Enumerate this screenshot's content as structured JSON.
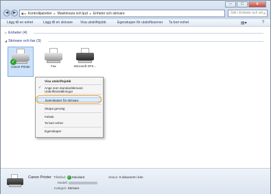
{
  "address": {
    "crumbs": [
      "Kontrollpanelen",
      "Maskinvara och ljud",
      "Enheter och skrivare"
    ],
    "search_placeholder": "Sök i Enheter och skr..."
  },
  "window_controls": {
    "minimize": "–",
    "maximize": "□",
    "close": "x"
  },
  "toolbar": {
    "items": [
      "Lägg till en enhet",
      "Lägg till en skrivare",
      "Visa utskriftsjobb",
      "Egenskaper för utskriftsserver",
      "Ta bort enhet"
    ]
  },
  "groups": {
    "devices": "Enheter (4)",
    "printers": "Skrivare och fax (3)"
  },
  "printers": [
    {
      "label": "Canon Printer",
      "status": "default"
    },
    {
      "label": "Fax",
      "status": ""
    },
    {
      "label": "Microsoft XPS...",
      "status": ""
    }
  ],
  "context_menu": {
    "items": [
      {
        "label": "Visa utskriftsjobb",
        "bold": true,
        "checked": false
      },
      {
        "label": "Ange som standardskrivare",
        "bold": false,
        "checked": true
      },
      {
        "label": "Utskriftsinställningar",
        "bold": false,
        "checked": false
      },
      {
        "label": "Egenskaper för skrivare",
        "bold": false,
        "checked": false,
        "highlighted": true
      },
      {
        "label": "Skapa genväg",
        "bold": false,
        "checked": false
      },
      {
        "label": "Felsök",
        "bold": false,
        "checked": false
      },
      {
        "label": "Ta bort enhet",
        "bold": false,
        "checked": false
      },
      {
        "label": "Egenskaper",
        "bold": false,
        "checked": false
      }
    ]
  },
  "details": {
    "name": "Canon Printer",
    "state_key": "Tillstånd:",
    "state_val": "Standard",
    "status_key": "Status:",
    "status_val": "0 dokument i kön",
    "model_key": "Modell:",
    "category_key": "Kategori:",
    "category_val": "Skrivare"
  },
  "colors": {
    "highlight_ring": "#f0a030",
    "selection": "#cce2fb",
    "check_green": "#2fa32f"
  }
}
